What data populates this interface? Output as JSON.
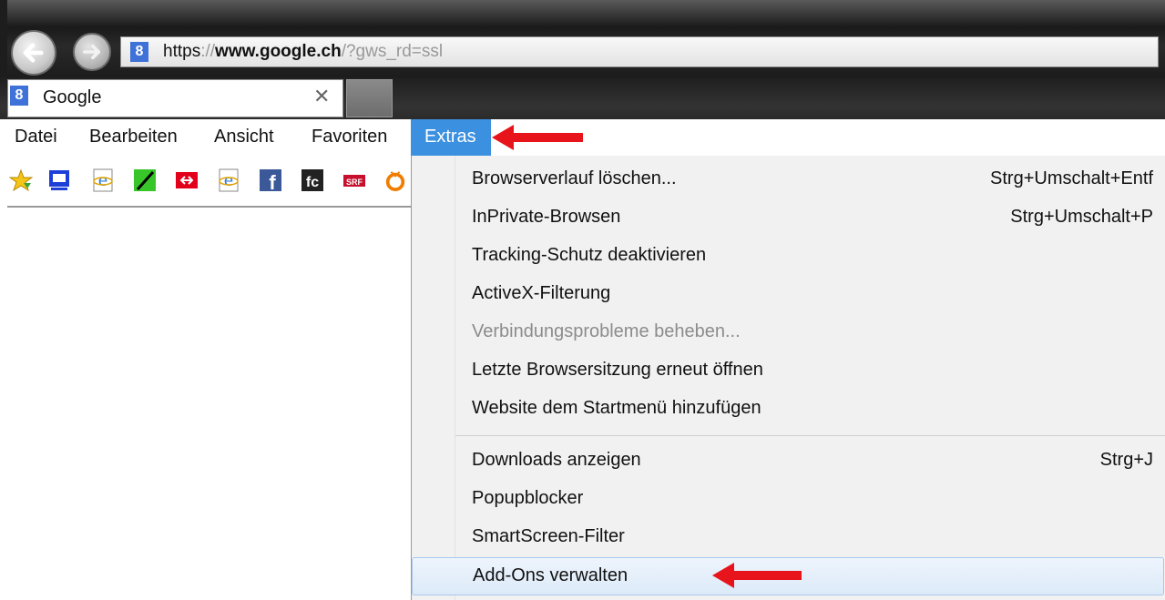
{
  "address_bar": {
    "scheme": "https",
    "colon": "://",
    "host": "www.google.ch",
    "path": "/?gws_rd=ssl",
    "favicon_letter": "8"
  },
  "tab": {
    "title": "Google",
    "close_glyph": "✕",
    "favicon_letter": "8"
  },
  "menubar": {
    "items": [
      "Datei",
      "Bearbeiten",
      "Ansicht",
      "Favoriten",
      "Extras"
    ],
    "active": "Extras"
  },
  "favorites_bar": {
    "icons": [
      "favorites-star-icon",
      "screen-icon",
      "ie-page-icon",
      "green-slash-icon",
      "sbb-icon",
      "ie-page-icon",
      "facebook-icon",
      "fc-icon",
      "srf-icon",
      "orange-tv-icon"
    ],
    "srf_text": "SRF",
    "fc_text": "fc",
    "fb_text": "f"
  },
  "extras_menu": {
    "items": [
      {
        "label": "Browserverlauf löschen...",
        "shortcut": "Strg+Umschalt+Entf",
        "enabled": true
      },
      {
        "label": "InPrivate-Browsen",
        "shortcut": "Strg+Umschalt+P",
        "enabled": true
      },
      {
        "label": "Tracking-Schutz deaktivieren",
        "shortcut": "",
        "enabled": true
      },
      {
        "label": "ActiveX-Filterung",
        "shortcut": "",
        "enabled": true
      },
      {
        "label": "Verbindungsprobleme beheben...",
        "shortcut": "",
        "enabled": false
      },
      {
        "label": "Letzte Browsersitzung erneut öffnen",
        "shortcut": "",
        "enabled": true
      },
      {
        "label": "Website dem Startmenü hinzufügen",
        "shortcut": "",
        "enabled": true
      },
      {
        "label": "Downloads anzeigen",
        "shortcut": "Strg+J",
        "enabled": true
      },
      {
        "label": "Popupblocker",
        "shortcut": "",
        "enabled": true
      },
      {
        "label": "SmartScreen-Filter",
        "shortcut": "",
        "enabled": true
      },
      {
        "label": "Add-Ons verwalten",
        "shortcut": "",
        "enabled": true,
        "highlighted": true
      }
    ]
  },
  "colors": {
    "menu_highlight": "#3b90e0",
    "annotation_arrow": "#e8141b",
    "disabled_text": "#8c8c8c"
  }
}
